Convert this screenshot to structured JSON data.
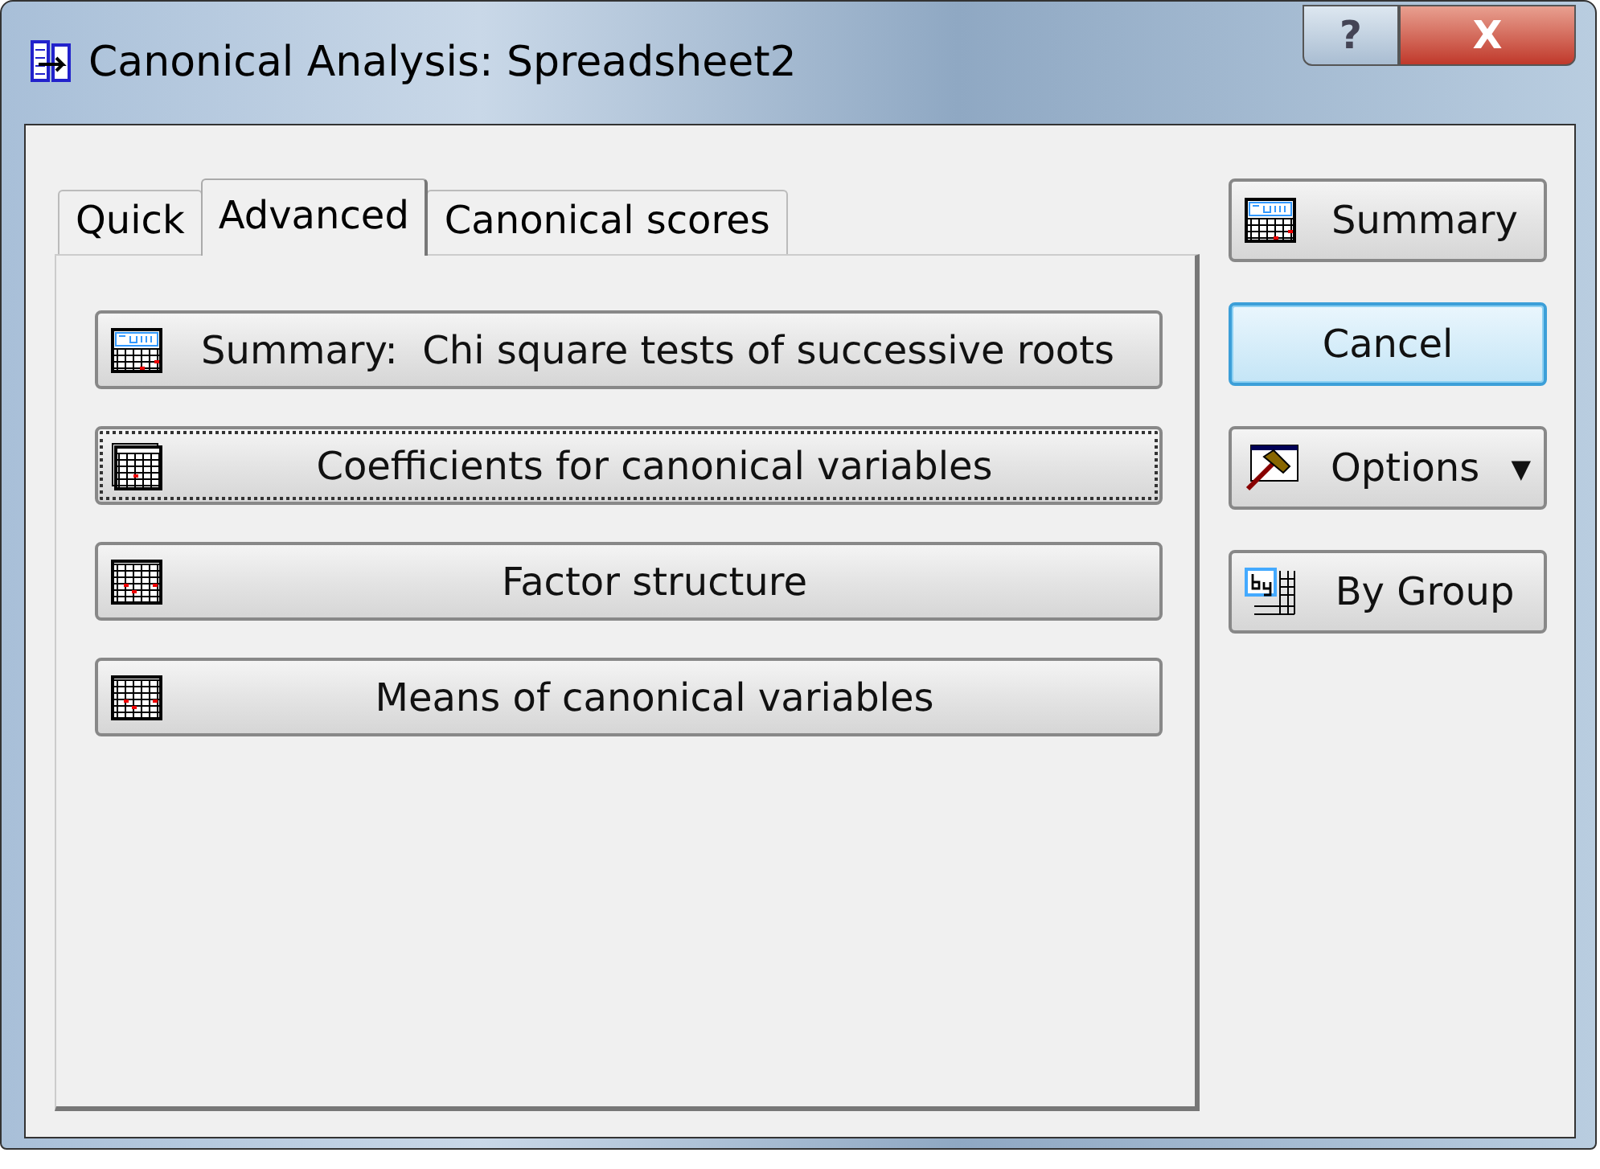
{
  "window": {
    "title": "Canonical Analysis: Spreadsheet2",
    "help": "?",
    "close": "X"
  },
  "tabs": [
    {
      "label": "Quick",
      "selected": false
    },
    {
      "label": "Advanced",
      "selected": true
    },
    {
      "label": "Canonical scores",
      "selected": false
    }
  ],
  "actions": [
    {
      "label": "Summary:  Chi square tests of successive roots",
      "kind": "summary",
      "focused": false
    },
    {
      "label": "Coefficients for canonical variables",
      "kind": "stacked",
      "focused": true
    },
    {
      "label": "Factor structure",
      "kind": "table",
      "focused": false
    },
    {
      "label": "Means of canonical variables",
      "kind": "table",
      "focused": false
    }
  ],
  "side_buttons": [
    {
      "label": "Summary",
      "kind": "summary",
      "default": false
    },
    {
      "label": "Cancel",
      "kind": "plain",
      "default": true
    },
    {
      "label": "Options",
      "kind": "options",
      "default": false,
      "caret": "▼"
    },
    {
      "label": "By Group",
      "kind": "bygroup",
      "default": false
    }
  ]
}
